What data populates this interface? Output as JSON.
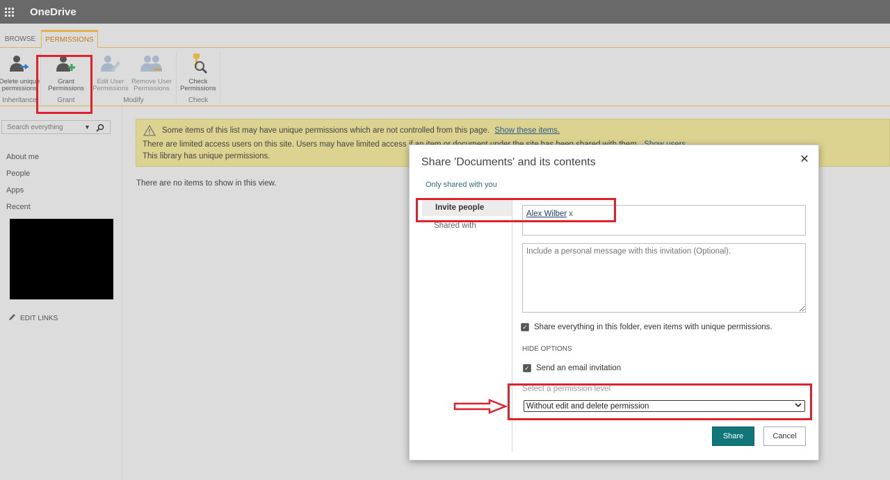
{
  "app": {
    "title": "OneDrive"
  },
  "tabs": {
    "browse": "BROWSE",
    "permissions": "PERMISSIONS"
  },
  "ribbon": {
    "delete_unique": "Delete unique permissions",
    "grant": "Grant Permissions",
    "edit_user": "Edit User Permissions",
    "remove_user": "Remove User Permissions",
    "check": "Check Permissions",
    "groups": {
      "inheritance": "Inheritance",
      "grant": "Grant",
      "modify": "Modify",
      "check": "Check"
    }
  },
  "leftnav": {
    "search_placeholder": "Search everything",
    "items": [
      "About me",
      "People",
      "Apps",
      "Recent"
    ],
    "edit_links": "EDIT LINKS"
  },
  "banner": {
    "line1": "Some items of this list may have unique permissions which are not controlled from this page.",
    "line1_link": "Show these items.",
    "line2": "There are limited access users on this site. Users may have limited access if an item or document under the site has been shared with them.",
    "line2_link": "Show users.",
    "line3": "This library has unique permissions."
  },
  "main": {
    "empty_text": "There are no items to show in this view."
  },
  "dialog": {
    "title": "Share 'Documents' and its contents",
    "shared_link": "Only shared with you",
    "tab_invite": "Invite people",
    "tab_shared": "Shared with",
    "person_token": "Alex Wilber",
    "token_remove": "x",
    "message_placeholder": "Include a personal message with this invitation (Optional).",
    "share_everything": "Share everything in this folder, even items with unique permissions.",
    "hide_options": "HIDE OPTIONS",
    "send_email": "Send an email invitation",
    "permission_label": "Select a permission level",
    "permission_value": "Without edit and delete permission",
    "share_button": "Share",
    "cancel_button": "Cancel",
    "close": "✕"
  },
  "colors": {
    "accent": "#10767a",
    "annotation": "#e0202a",
    "ribbon_tab": "#e2b34b"
  }
}
